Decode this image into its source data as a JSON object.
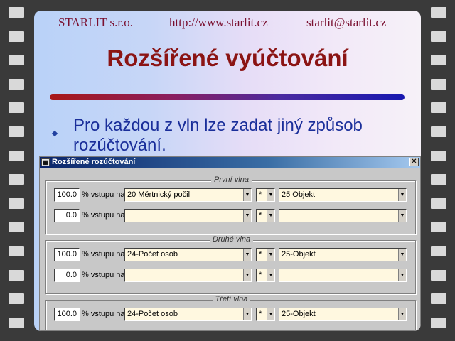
{
  "header": {
    "company": "STARLIT s.r.o.",
    "url": "http://www.starlit.cz",
    "email": "starlit@starlit.cz"
  },
  "title": "Rozšířené vyúčtování",
  "bullet": "Pro každou z vln lze zadat jiný způsob rozúčtování.",
  "dialog": {
    "title": "Rozšířené rozúčtování",
    "icon": "app-icon",
    "close_label": "✕",
    "pct_label": "% vstupu na",
    "groups": [
      {
        "label": "První vlna",
        "rows": [
          {
            "pct": "100.0",
            "source": "20 Měrtnický počil",
            "op": "*",
            "target": "25 Objekt"
          },
          {
            "pct": "0.0",
            "source": "",
            "op": "*",
            "target": ""
          }
        ]
      },
      {
        "label": "Druhé vlna",
        "rows": [
          {
            "pct": "100.0",
            "source": "24-Počet osob",
            "op": "*",
            "target": "25-Objekt"
          },
          {
            "pct": "0.0",
            "source": "",
            "op": "*",
            "target": ""
          }
        ]
      },
      {
        "label": "Třetí vlna",
        "rows": [
          {
            "pct": "100.0",
            "source": "24-Počet osob",
            "op": "*",
            "target": "25-Objekt"
          }
        ]
      }
    ]
  }
}
